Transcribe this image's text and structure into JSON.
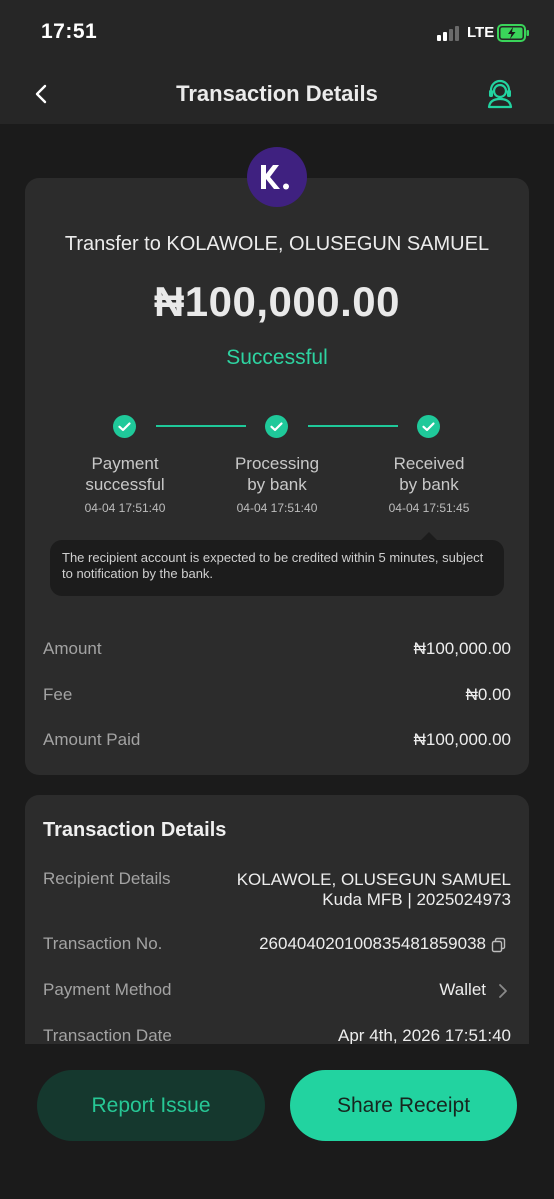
{
  "status_bar": {
    "time": "17:51",
    "network": "LTE",
    "signal_bars_active": 2,
    "signal_bars_total": 4,
    "battery_state": "charging"
  },
  "nav": {
    "back_icon": "chevron-left-icon",
    "title": "Transaction Details",
    "support_icon": "customer-support-headset-icon"
  },
  "summary": {
    "logo_letter": "K.",
    "recipient_title": "Transfer to KOLAWOLE, OLUSEGUN SAMUEL",
    "amount": "₦100,000.00",
    "status": "Successful"
  },
  "progress": {
    "steps": [
      {
        "label_line1": "Payment",
        "label_line2": "successful",
        "time": "04-04 17:51:40",
        "icon": "check-icon"
      },
      {
        "label_line1": "Processing",
        "label_line2": "by bank",
        "time": "04-04 17:51:40",
        "icon": "check-icon"
      },
      {
        "label_line1": "Received",
        "label_line2": "by bank",
        "time": "04-04 17:51:45",
        "icon": "check-icon"
      }
    ],
    "note": "The recipient account is expected to be credited within 5 minutes, subject to notification by the bank."
  },
  "breakdown": [
    {
      "label": "Amount",
      "value": "₦100,000.00"
    },
    {
      "label": "Fee",
      "value": "₦0.00"
    },
    {
      "label": "Amount Paid",
      "value": "₦100,000.00"
    }
  ],
  "details": {
    "title": "Transaction Details",
    "recipient_label": "Recipient Details",
    "recipient_name": "KOLAWOLE, OLUSEGUN SAMUEL",
    "recipient_bank": "Kuda MFB | 2025024973",
    "txn_no_label": "Transaction No.",
    "txn_no": "260404020100835481859038",
    "payment_method_label": "Payment Method",
    "payment_method": "Wallet",
    "txn_date_label": "Transaction Date",
    "txn_date": "Apr 4th, 2026 17:51:40"
  },
  "actions": {
    "report": "Report Issue",
    "share": "Share Receipt"
  },
  "colors": {
    "accent": "#22d3a0",
    "success_text": "#2ed3a1",
    "logo_bg": "#3f2180",
    "card_bg": "#2c2c2c",
    "page_bg": "#1b1b1b"
  }
}
